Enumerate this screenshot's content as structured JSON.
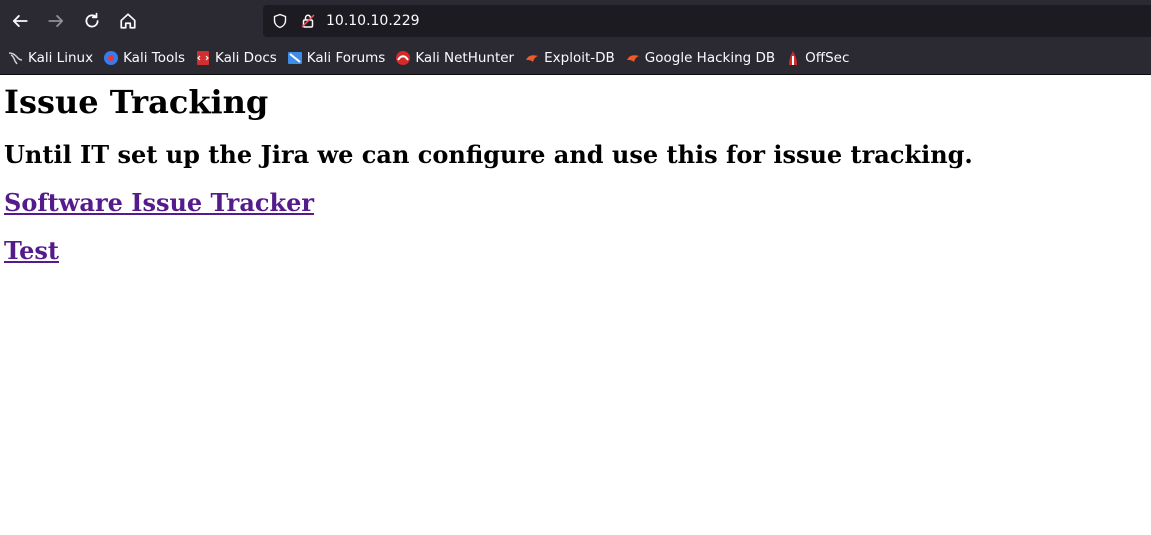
{
  "browser": {
    "url": "10.10.10.229",
    "bookmarks": [
      {
        "label": "Kali Linux",
        "icon": "kali-dragon-icon"
      },
      {
        "label": "Kali Tools",
        "icon": "kali-tools-icon"
      },
      {
        "label": "Kali Docs",
        "icon": "kali-docs-icon"
      },
      {
        "label": "Kali Forums",
        "icon": "kali-forums-icon"
      },
      {
        "label": "Kali NetHunter",
        "icon": "kali-nethunter-icon"
      },
      {
        "label": "Exploit-DB",
        "icon": "exploit-db-icon"
      },
      {
        "label": "Google Hacking DB",
        "icon": "ghdb-icon"
      },
      {
        "label": "OffSec",
        "icon": "offsec-icon"
      }
    ]
  },
  "page": {
    "title": "Issue Tracking",
    "subtitle": "Until IT set up the Jira we can configure and use this for issue tracking.",
    "links": [
      {
        "label": "Software Issue Tracker"
      },
      {
        "label": "Test"
      }
    ]
  }
}
